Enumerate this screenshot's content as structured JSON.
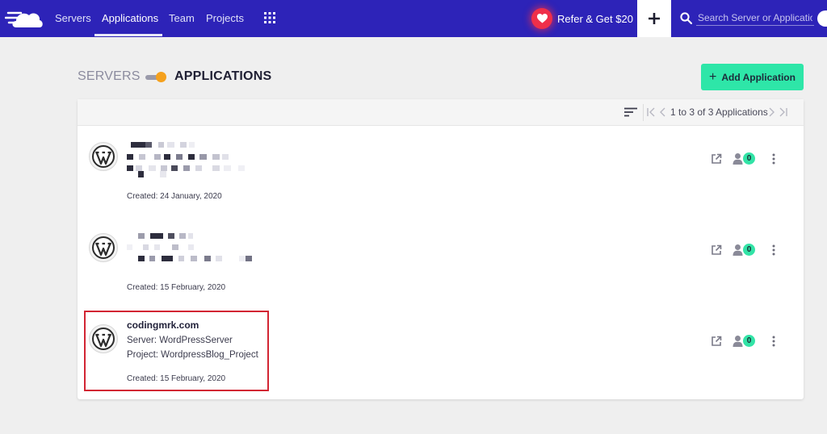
{
  "nav": {
    "links": [
      "Servers",
      "Applications",
      "Team",
      "Projects"
    ],
    "refer_label": "Refer & Get $20",
    "search_placeholder": "Search Server or Application",
    "colors": {
      "bar": "#2d23b8",
      "refer_heart": "#ef2f4a"
    }
  },
  "page": {
    "toggle_left_label": "SERVERS",
    "toggle_right_label": "APPLICATIONS",
    "add_button_label": "Add Application",
    "accent_color": "#2ee6a8"
  },
  "list": {
    "pagination_text": "1 to 3 of 3 Applications",
    "apps": [
      {
        "name": "",
        "server": "",
        "project": "",
        "created": "Created: 24 January, 2020",
        "member_count": "0",
        "redacted": true
      },
      {
        "name": "",
        "server": "",
        "project": "",
        "created": "Created: 15 February, 2020",
        "member_count": "0",
        "redacted": true
      },
      {
        "name": "codingmrk.com",
        "server": "Server: WordPressServer",
        "project": "Project: WordpressBlog_Project",
        "created": "Created: 15 February, 2020",
        "member_count": "0",
        "redacted": false
      }
    ]
  },
  "icons": {
    "logo": "cloudways-cloud-logo",
    "apps_menu": "grid-icon",
    "heart": "heart-icon",
    "add_new": "plus-icon",
    "search": "search-icon",
    "sort": "sort-icon",
    "first_page": "first-page-icon",
    "prev_page": "chevron-left-icon",
    "next_page": "chevron-right-icon",
    "last_page": "last-page-icon",
    "app": "wordpress-icon",
    "open_app": "external-link-icon",
    "members": "user-icon",
    "row_menu": "more-vertical-icon"
  }
}
